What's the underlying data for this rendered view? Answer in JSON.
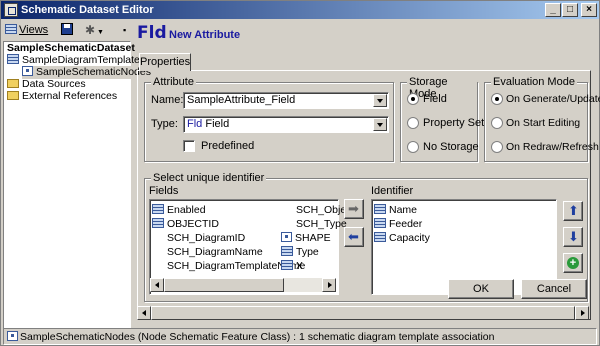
{
  "window": {
    "title": "Schematic Dataset Editor"
  },
  "toolbar": {
    "views_label": "Views"
  },
  "tree": {
    "root": "SampleSchematicDataset",
    "template": "SampleDiagramTemplate",
    "nodes": "SampleSchematicNodes",
    "data_sources": "Data Sources",
    "external_references": "External References"
  },
  "header": {
    "abbrev": "Fld",
    "title": "New Attribute"
  },
  "tabs": {
    "properties": "Properties"
  },
  "attribute": {
    "group_label": "Attribute",
    "name_label": "Name:",
    "name_value": "SampleAttribute_Field",
    "type_label": "Type:",
    "type_abbrev": "Fld",
    "type_value": "Field",
    "predefined_label": "Predefined"
  },
  "storage_mode": {
    "group_label": "Storage Mode",
    "options": [
      "Field",
      "Property Set",
      "No Storage"
    ],
    "selected": "Field"
  },
  "evaluation_mode": {
    "group_label": "Evaluation Mode",
    "options": [
      "On Generate/Update",
      "On Start Editing",
      "On Redraw/Refresh"
    ],
    "selected": "On Generate/Update"
  },
  "unique_identifier": {
    "group_label": "Select unique identifier",
    "fields_label": "Fields",
    "identifier_label": "Identifier",
    "fields_col1": [
      "Enabled",
      "OBJECTID",
      "SCH_DiagramID",
      "SCH_DiagramName",
      "SCH_DiagramTemplateName"
    ],
    "fields_col2": [
      "SCH_Obje",
      "SCH_Type",
      "SHAPE",
      "Type",
      "X"
    ],
    "identifier_items": [
      "Name",
      "Feeder",
      "Capacity"
    ],
    "identifier_selected": "Feeder"
  },
  "buttons": {
    "ok": "OK",
    "cancel": "Cancel"
  },
  "status": {
    "text": "SampleSchematicNodes (Node Schematic Feature Class) : 1 schematic diagram template association"
  },
  "colors": {
    "title_start": "#0a246a",
    "title_end": "#a6caf0",
    "selection": "#0a246a",
    "header_text": "#1a1aa0",
    "face": "#d4d0c8"
  }
}
